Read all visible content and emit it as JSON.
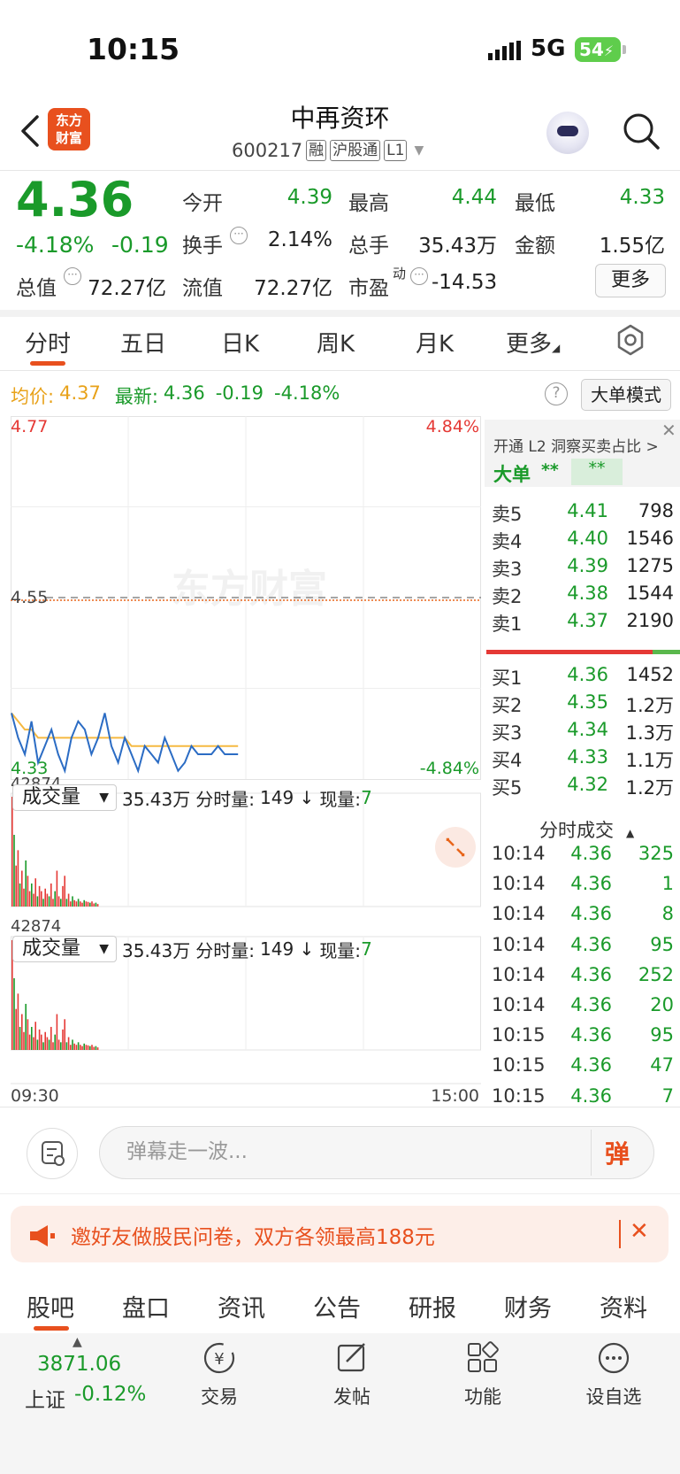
{
  "status_bar": {
    "time": "10:15",
    "network": "5G",
    "battery": "54"
  },
  "header": {
    "logo_line1": "东方",
    "logo_line2": "财富",
    "stock_name": "中再资环",
    "stock_code": "600217",
    "tags": [
      "融",
      "沪股通",
      "L1"
    ]
  },
  "quote": {
    "price": "4.36",
    "change_pct": "-4.18%",
    "change": "-0.19",
    "open_label": "今开",
    "open": "4.39",
    "high_label": "最高",
    "high": "4.44",
    "low_label": "最低",
    "low": "4.33",
    "turnover_label": "换手",
    "turnover": "2.14%",
    "volume_label": "总手",
    "volume": "35.43万",
    "amount_label": "金额",
    "amount": "1.55亿",
    "mktcap_label": "总值",
    "mktcap": "72.27亿",
    "float_label": "流值",
    "float_cap": "72.27亿",
    "pe_label": "市盈",
    "pe_sup": "动",
    "pe": "-14.53",
    "more_label": "更多"
  },
  "tabs": [
    "分时",
    "五日",
    "日K",
    "周K",
    "月K",
    "更多"
  ],
  "info": {
    "avg_label": "均价:",
    "avg": "4.37",
    "latest_label": "最新:",
    "latest": "4.36",
    "latest_chg": "-0.19",
    "latest_pct": "-4.18%",
    "big_order_mode": "大单模式"
  },
  "chart_data": {
    "type": "line",
    "y_top": "4.77",
    "y_mid": "4.55",
    "y_bottom": "4.33",
    "pct_top": "4.84%",
    "pct_bottom": "-4.84%",
    "ylim": [
      4.33,
      4.77
    ],
    "prev_close": 4.55,
    "series": [
      {
        "values": [
          4.41,
          4.38,
          4.36,
          4.4,
          4.35,
          4.37,
          4.39,
          4.36,
          4.34,
          4.38,
          4.4,
          4.39,
          4.36,
          4.38,
          4.41,
          4.37,
          4.35,
          4.38,
          4.36,
          4.34,
          4.37,
          4.36,
          4.35,
          4.38,
          4.36,
          4.34,
          4.35,
          4.37,
          4.36,
          4.36,
          4.36,
          4.37,
          4.36,
          4.36,
          4.36
        ]
      },
      {
        "values": [
          4.41,
          4.4,
          4.39,
          4.39,
          4.38,
          4.38,
          4.38,
          4.38,
          4.38,
          4.38,
          4.38,
          4.38,
          4.38,
          4.38,
          4.38,
          4.38,
          4.38,
          4.38,
          4.37,
          4.37,
          4.37,
          4.37,
          4.37,
          4.37,
          4.37,
          4.37,
          4.37,
          4.37,
          4.37,
          4.37,
          4.37,
          4.37,
          4.37,
          4.37,
          4.37
        ]
      }
    ],
    "x_start": "09:30",
    "x_end": "15:00",
    "volume": {
      "selector": "成交量",
      "total": "35.43万",
      "interval_label": "分时量:",
      "interval": "149 ↓",
      "now_label": "现量:",
      "now": "7",
      "max": "42874",
      "bars": [
        42874,
        28000,
        16000,
        22000,
        9000,
        14000,
        7000,
        18000,
        12000,
        6000,
        9000,
        5000,
        11000,
        4000,
        8000,
        6000,
        3000,
        7000,
        5000,
        4000,
        9000,
        3000,
        6000,
        14000,
        4000,
        3000,
        8000,
        12000,
        3000,
        5000,
        2000,
        4000,
        2500,
        2000,
        3000,
        2000,
        1500,
        2500,
        2000,
        1800,
        1500,
        2000,
        1200,
        1500,
        1000
      ]
    }
  },
  "l2": {
    "promo": "开通 L2 洞察买卖占比 >",
    "big_label": "大单",
    "stars1": "**",
    "stars2": "**"
  },
  "order_book": {
    "asks": [
      {
        "label": "卖5",
        "price": "4.41",
        "vol": "798"
      },
      {
        "label": "卖4",
        "price": "4.40",
        "vol": "1546"
      },
      {
        "label": "卖3",
        "price": "4.39",
        "vol": "1275"
      },
      {
        "label": "卖2",
        "price": "4.38",
        "vol": "1544"
      },
      {
        "label": "卖1",
        "price": "4.37",
        "vol": "2190"
      }
    ],
    "bids": [
      {
        "label": "买1",
        "price": "4.36",
        "vol": "1452"
      },
      {
        "label": "买2",
        "price": "4.35",
        "vol": "1.2万"
      },
      {
        "label": "买3",
        "price": "4.34",
        "vol": "1.3万"
      },
      {
        "label": "买4",
        "price": "4.33",
        "vol": "1.1万"
      },
      {
        "label": "买5",
        "price": "4.32",
        "vol": "1.2万"
      }
    ]
  },
  "ticks": {
    "title": "分时成交",
    "rows": [
      {
        "time": "10:14",
        "price": "4.36",
        "vol": "325"
      },
      {
        "time": "10:14",
        "price": "4.36",
        "vol": "1"
      },
      {
        "time": "10:14",
        "price": "4.36",
        "vol": "8"
      },
      {
        "time": "10:14",
        "price": "4.36",
        "vol": "95"
      },
      {
        "time": "10:14",
        "price": "4.36",
        "vol": "252"
      },
      {
        "time": "10:14",
        "price": "4.36",
        "vol": "20"
      },
      {
        "time": "10:15",
        "price": "4.36",
        "vol": "95"
      },
      {
        "time": "10:15",
        "price": "4.36",
        "vol": "47"
      },
      {
        "time": "10:15",
        "price": "4.36",
        "vol": "7"
      }
    ]
  },
  "comment": {
    "placeholder": "弹幕走一波...",
    "danmu_btn": "弹"
  },
  "banner": {
    "text": "邀好友做股民问卷，双方各领最高188元"
  },
  "bottom_tabs": [
    "股吧",
    "盘口",
    "资讯",
    "公告",
    "研报",
    "财务",
    "资料"
  ],
  "footer": {
    "index_value": "3871.06",
    "index_name": "上证",
    "index_pct": "-0.12%",
    "items": [
      "交易",
      "发帖",
      "功能",
      "设自选"
    ]
  },
  "colors": {
    "up": "#e53935",
    "down": "#1a9a2a",
    "accent": "#e8501e",
    "avg_line": "#f5b942",
    "price_line": "#2b6cc4"
  }
}
